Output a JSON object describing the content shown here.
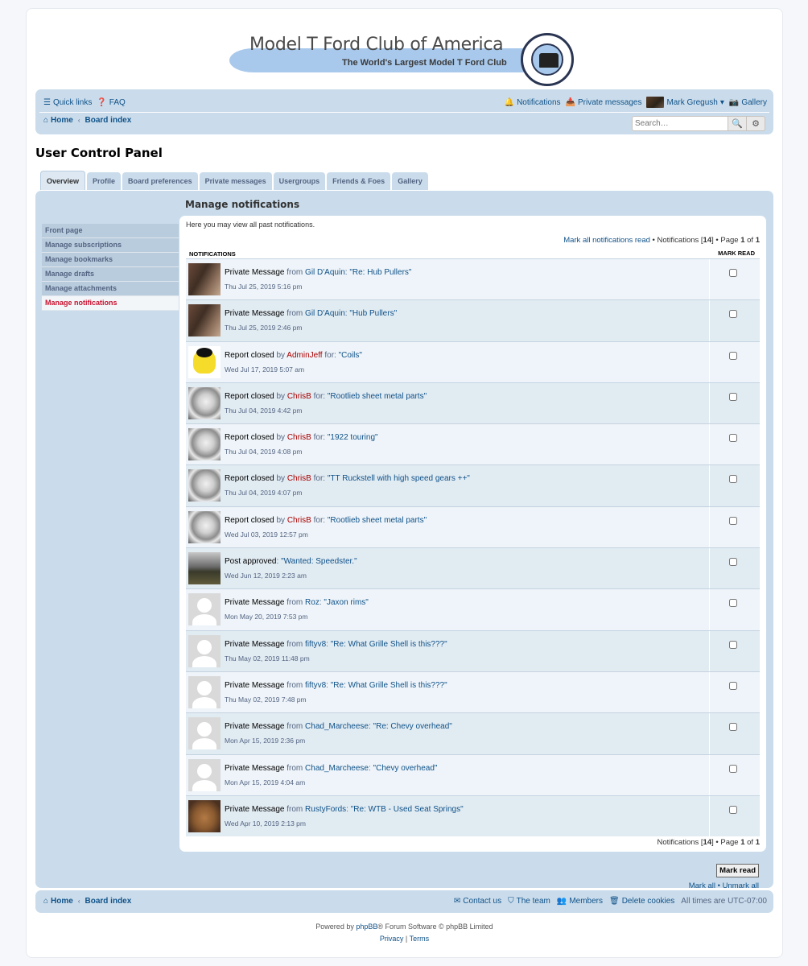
{
  "logo": {
    "title": "Model T Ford Club of America",
    "tagline": "The World's Largest Model T Ford Club"
  },
  "header": {
    "quick_links": "Quick links",
    "faq": "FAQ",
    "notifications": "Notifications",
    "private_messages": "Private messages",
    "username": "Mark Gregush",
    "gallery": "Gallery",
    "home": "Home",
    "board_index": "Board index",
    "search_placeholder": "Search…"
  },
  "page_title": "User Control Panel",
  "tabs": [
    "Overview",
    "Profile",
    "Board preferences",
    "Private messages",
    "Usergroups",
    "Friends & Foes",
    "Gallery"
  ],
  "side_menu": [
    "Front page",
    "Manage subscriptions",
    "Manage bookmarks",
    "Manage drafts",
    "Manage attachments",
    "Manage notifications"
  ],
  "manage": {
    "title": "Manage notifications",
    "intro": "Here you may view all past notifications.",
    "mark_all_read": "Mark all notifications read",
    "count_text_pre": "Notifications [",
    "count": "14",
    "count_text_post": "] • Page ",
    "page": "1",
    "of": " of ",
    "pages": "1",
    "bullet": " • ",
    "col_notifications": "NOTIFICATIONS",
    "col_mark_read": "MARK READ"
  },
  "notifications": [
    {
      "type": "Private Message",
      "connector": " from ",
      "user": "Gil D'Aquin",
      "user_red": false,
      "sep": ": ",
      "topic": "\"Re: Hub Pullers\"",
      "date": "Thu Jul 25, 2019 5:16 pm",
      "avatar": "car"
    },
    {
      "type": "Private Message",
      "connector": " from ",
      "user": "Gil D'Aquin",
      "user_red": false,
      "sep": ": ",
      "topic": "\"Hub Pullers\"",
      "date": "Thu Jul 25, 2019 2:46 pm",
      "avatar": "car"
    },
    {
      "type": "Report closed",
      "connector": " by ",
      "user": "AdminJeff",
      "user_red": true,
      "sep": " for: ",
      "topic": "\"Coils\"",
      "date": "Wed Jul 17, 2019 5:07 am",
      "avatar": "yellow"
    },
    {
      "type": "Report closed",
      "connector": " by ",
      "user": "ChrisB",
      "user_red": true,
      "sep": " for: ",
      "topic": "\"Rootlieb sheet metal parts\"",
      "date": "Thu Jul 04, 2019 4:42 pm",
      "avatar": "rim"
    },
    {
      "type": "Report closed",
      "connector": " by ",
      "user": "ChrisB",
      "user_red": true,
      "sep": " for: ",
      "topic": "\"1922 touring\"",
      "date": "Thu Jul 04, 2019 4:08 pm",
      "avatar": "rim"
    },
    {
      "type": "Report closed",
      "connector": " by ",
      "user": "ChrisB",
      "user_red": true,
      "sep": " for: ",
      "topic": "\"TT Ruckstell with high speed gears ++\"",
      "date": "Thu Jul 04, 2019 4:07 pm",
      "avatar": "rim"
    },
    {
      "type": "Report closed",
      "connector": " by ",
      "user": "ChrisB",
      "user_red": true,
      "sep": " for: ",
      "topic": "\"Rootlieb sheet metal parts\"",
      "date": "Wed Jul 03, 2019 12:57 pm",
      "avatar": "rim"
    },
    {
      "type": "Post approved",
      "connector": "",
      "user": "",
      "user_red": false,
      "sep": ": ",
      "topic": "\"Wanted: Speedster.\"",
      "date": "Wed Jun 12, 2019 2:23 am",
      "avatar": "speed"
    },
    {
      "type": "Private Message",
      "connector": " from ",
      "user": "Roz",
      "user_red": false,
      "sep": ": ",
      "topic": "\"Jaxon rims\"",
      "date": "Mon May 20, 2019 7:53 pm",
      "avatar": "default"
    },
    {
      "type": "Private Message",
      "connector": " from ",
      "user": "fiftyv8",
      "user_red": false,
      "sep": ": ",
      "topic": "\"Re: What Grille Shell is this???\"",
      "date": "Thu May 02, 2019 11:48 pm",
      "avatar": "default"
    },
    {
      "type": "Private Message",
      "connector": " from ",
      "user": "fiftyv8",
      "user_red": false,
      "sep": ": ",
      "topic": "\"Re: What Grille Shell is this???\"",
      "date": "Thu May 02, 2019 7:48 pm",
      "avatar": "default"
    },
    {
      "type": "Private Message",
      "connector": " from ",
      "user": "Chad_Marcheese",
      "user_red": false,
      "sep": ": ",
      "topic": "\"Re: Chevy overhead\"",
      "date": "Mon Apr 15, 2019 2:36 pm",
      "avatar": "default"
    },
    {
      "type": "Private Message",
      "connector": " from ",
      "user": "Chad_Marcheese",
      "user_red": false,
      "sep": ": ",
      "topic": "\"Chevy overhead\"",
      "date": "Mon Apr 15, 2019 4:04 am",
      "avatar": "default"
    },
    {
      "type": "Private Message",
      "connector": " from ",
      "user": "RustyFords",
      "user_red": false,
      "sep": ": ",
      "topic": "\"Re: WTB - Used Seat Springs\"",
      "date": "Wed Apr 10, 2019 2:13 pm",
      "avatar": "dog"
    }
  ],
  "actions": {
    "mark_read": "Mark read",
    "mark_all": "Mark all",
    "unmark_all": "Unmark all",
    "bullet": " • "
  },
  "footer": {
    "home": "Home",
    "board_index": "Board index",
    "contact_us": "Contact us",
    "the_team": "The team",
    "members": "Members",
    "delete_cookies": "Delete cookies",
    "timezone": "All times are UTC-07:00",
    "powered_pre": "Powered by ",
    "phpbb": "phpBB",
    "powered_post": "® Forum Software © phpBB Limited",
    "privacy": "Privacy",
    "pipe": " | ",
    "terms": "Terms"
  },
  "icons": {
    "quick_links": "bars-icon",
    "faq": "question-circle-icon",
    "notifications": "bell-icon",
    "private_messages": "inbox-icon",
    "gallery": "camera-icon",
    "home": "home-icon",
    "search": "search-icon",
    "advanced_search": "cog-icon",
    "contact": "envelope-icon",
    "team": "shield-icon",
    "members": "users-icon",
    "delete_cookies": "trash-icon"
  },
  "colors": {
    "navbar_bg": "#cadceb",
    "link": "#105289",
    "moderator_red": "#aa0000",
    "active_menu": "#c8102e"
  }
}
